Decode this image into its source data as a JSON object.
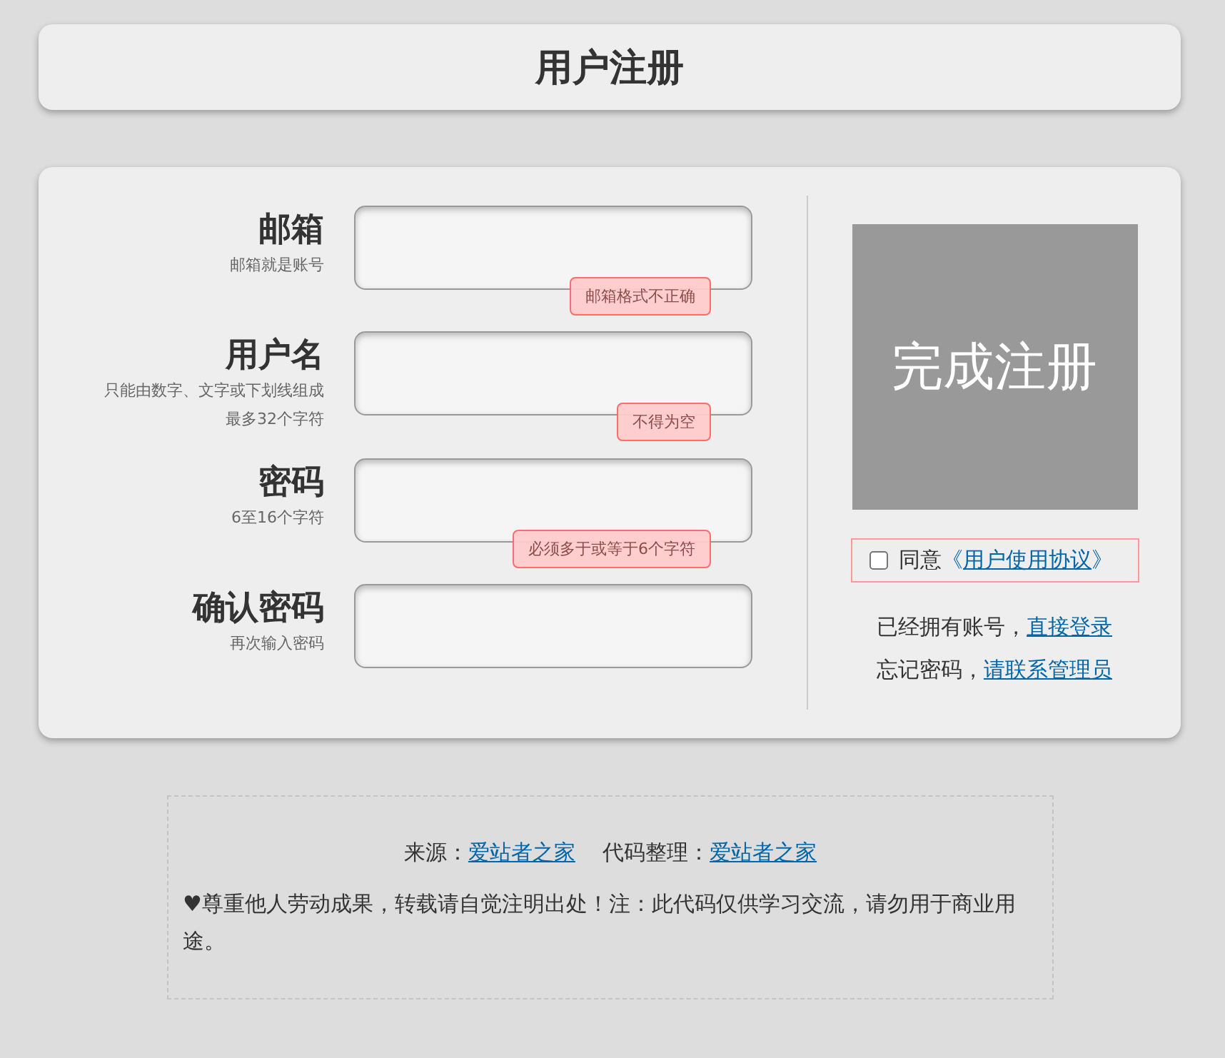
{
  "title": "用户注册",
  "fields": [
    {
      "label": "邮箱",
      "hints": [
        "邮箱就是账号"
      ],
      "error": "邮箱格式不正确"
    },
    {
      "label": "用户名",
      "hints": [
        "只能由数字、文字或下划线组成",
        "最多32个字符"
      ],
      "error": "不得为空"
    },
    {
      "label": "密码",
      "hints": [
        "6至16个字符"
      ],
      "error": "必须多于或等于6个字符"
    },
    {
      "label": "确认密码",
      "hints": [
        "再次输入密码"
      ]
    }
  ],
  "submit": "完成注册",
  "agreement": {
    "checked": false,
    "prefix": "同意",
    "open": "《",
    "link": "用户使用协议",
    "close": "》"
  },
  "links": [
    {
      "text": "已经拥有账号，",
      "link": "直接登录"
    },
    {
      "text": "忘记密码，",
      "link": "请联系管理员"
    }
  ],
  "footer": {
    "source": [
      {
        "text": "来源：",
        "link": "爱站者之家"
      },
      {
        "text": "代码整理：",
        "link": "爱站者之家"
      }
    ],
    "notice": "♥尊重他人劳动成果，转载请自觉注明出处！注：此代码仅供学习交流，请勿用于商业用途。"
  }
}
